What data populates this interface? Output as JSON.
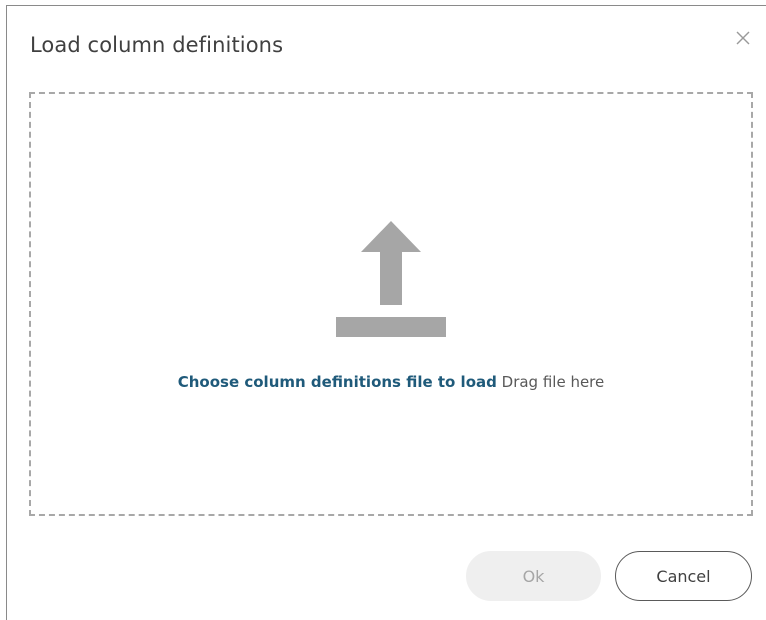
{
  "dialog": {
    "title": "Load column definitions",
    "close_icon": "close-icon"
  },
  "dropzone": {
    "icon": "upload-icon",
    "choose_link": "Choose column definitions file to load",
    "drag_text": "Drag file here"
  },
  "footer": {
    "ok_label": "Ok",
    "ok_enabled": false,
    "cancel_label": "Cancel"
  },
  "colors": {
    "link": "#1f5a7a",
    "icon": "#a6a6a6",
    "dashed_border": "#a8a8a8",
    "disabled_button_bg": "#efefef"
  }
}
